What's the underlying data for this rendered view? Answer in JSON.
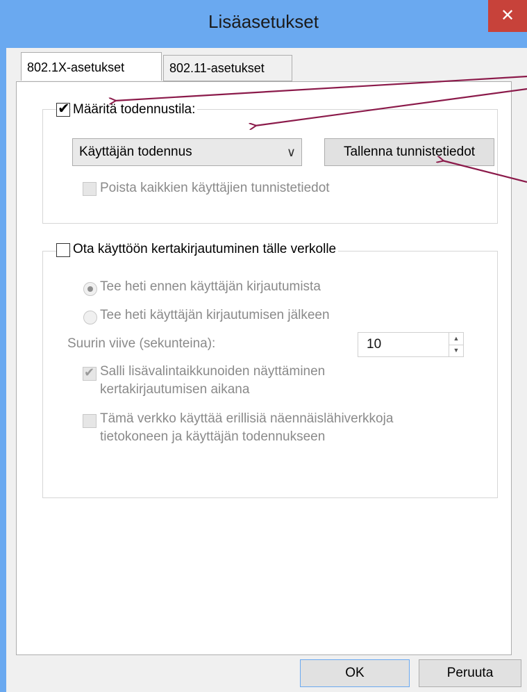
{
  "window": {
    "title": "Lisäasetukset",
    "close_label": "✕"
  },
  "tabs": [
    {
      "label": "802.1X-asetukset",
      "active": true
    },
    {
      "label": "802.11-asetukset",
      "active": false
    }
  ],
  "auth_group": {
    "checkbox_label": "Määritä todennustila:",
    "checked": true,
    "mode_select": {
      "value": "Käyttäjän todennus"
    },
    "save_credentials_button": "Tallenna tunnistetiedot",
    "delete_credentials_label": "Poista kaikkien käyttäjien tunnistetiedot"
  },
  "sso_group": {
    "checkbox_label": "Ota käyttöön kertakirjautuminen tälle verkolle",
    "radio_before": "Tee heti ennen käyttäjän kirjautumista",
    "radio_after": "Tee heti käyttäjän kirjautumisen jälkeen",
    "max_delay_label": "Suurin viive (sekunteina):",
    "max_delay_value": "10",
    "allow_dialogs_line1": "Salli lisävalintaikkunoiden näyttäminen",
    "allow_dialogs_line2": "kertakirjautumisen aikana",
    "separate_vlans_line1": "Tämä verkko käyttää erillisiä näennäislähiverkkoja",
    "separate_vlans_line2": "tietokoneen ja käyttäjän todennukseen"
  },
  "footer": {
    "ok_label": "OK",
    "cancel_label": "Peruuta"
  },
  "colors": {
    "titlebar": "#6aa9f0",
    "close": "#c7423a",
    "annotation_arrow": "#8b1a4a"
  }
}
